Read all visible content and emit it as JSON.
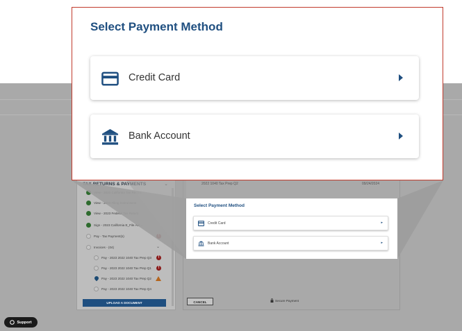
{
  "modal": {
    "title": "Select Payment Method",
    "options": [
      {
        "label": "Credit Card",
        "icon": "credit-card-icon"
      },
      {
        "label": "Bank Account",
        "icon": "bank-icon"
      }
    ]
  },
  "preview": {
    "title": "Select Payment Method",
    "options": [
      {
        "label": "Credit Card",
        "icon": "credit-card-icon"
      },
      {
        "label": "Bank Account",
        "icon": "bank-icon"
      }
    ]
  },
  "task_panel": {
    "title": "TAX RETURNS & PAYMENTS",
    "items": [
      {
        "label": "View - 2023 California Tax Return",
        "status": "done"
      },
      {
        "label": "View - 2023 Filing Instructions",
        "status": "done"
      },
      {
        "label": "View - 2023 Federal Tax Return",
        "status": "done"
      },
      {
        "label": "Sign - 2023 California E_File Aut...",
        "status": "done"
      },
      {
        "label": "Pay - Tax Payment(s)",
        "status": "open",
        "badge": "!"
      },
      {
        "label": "Invoices - (04)",
        "status": "open"
      },
      {
        "label": "Pay - 2023 2022 1040 Tax Prep Q3",
        "status": "open",
        "badge": "!"
      },
      {
        "label": "Pay - 2023 2022 1040 Tax Prep Q1",
        "status": "open",
        "badge": "!"
      },
      {
        "label": "Pay - 2023 2022 1040 Tax Prep Q2",
        "status": "current",
        "badge": "!"
      },
      {
        "label": "Pay - 2023 2022 1040 Tax Prep Q4",
        "status": "open"
      }
    ],
    "upload_label": "UPLOAD A DOCUMENT"
  },
  "main": {
    "row_text": "2022 1040 Tax Prep Q2",
    "row_date": "09/24/2024",
    "cancel_label": "CANCEL",
    "secure_label": "Secure Payment"
  },
  "support": {
    "label": "Support"
  },
  "colors": {
    "accent": "#1f4f80",
    "modal_border": "#c0392b",
    "overlay": "#a9a9a9"
  }
}
